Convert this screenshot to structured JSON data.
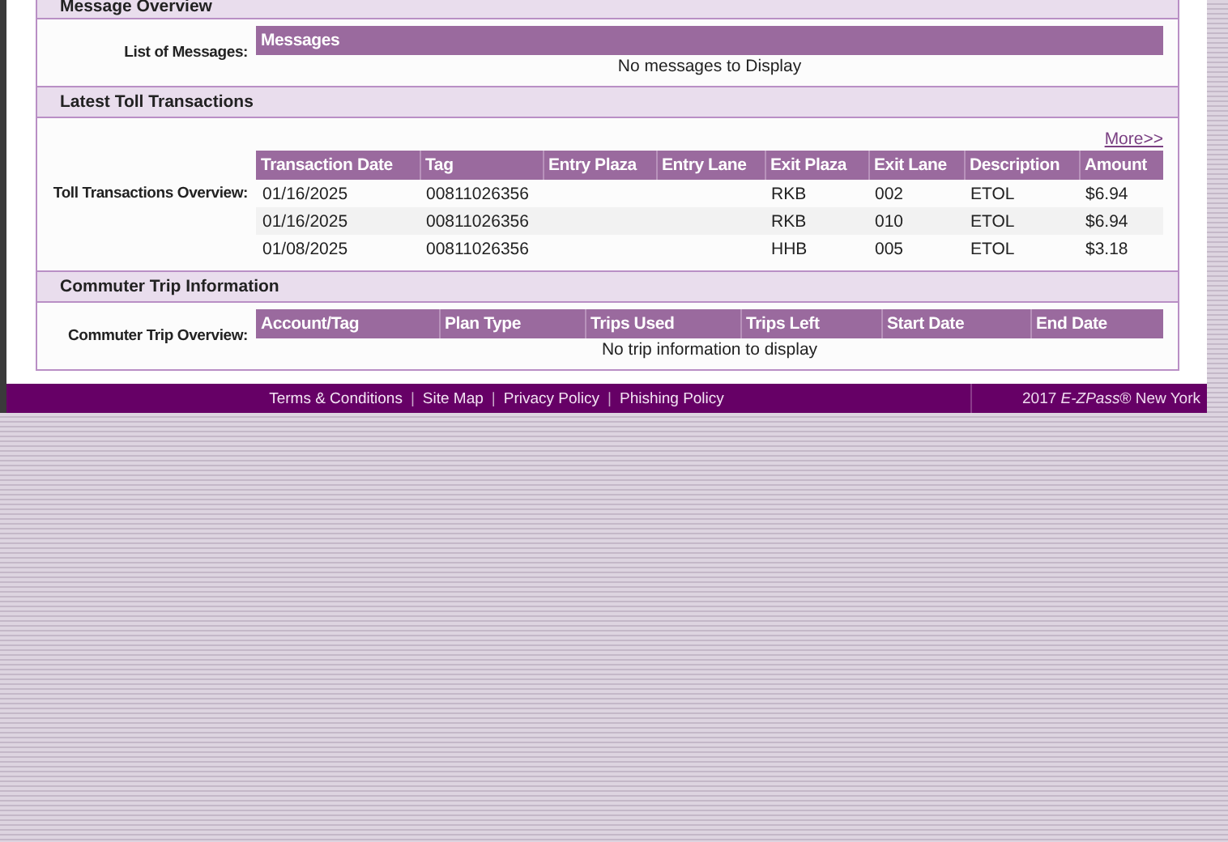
{
  "sections": [
    {
      "title": "Message Overview",
      "label": "List of Messages:",
      "table": {
        "columns": [
          "Messages"
        ],
        "empty_message": "No messages to Display"
      }
    },
    {
      "title": "Latest Toll Transactions",
      "label": "Toll Transactions Overview:",
      "more_link": "More>>",
      "table": {
        "columns": [
          "Transaction Date",
          "Tag",
          "Entry Plaza",
          "Entry Lane",
          "Exit Plaza",
          "Exit Lane",
          "Description",
          "Amount"
        ],
        "rows": [
          [
            "01/16/2025",
            "00811026356",
            null,
            null,
            "RKB",
            "002",
            "ETOL",
            "$6.94"
          ],
          [
            "01/16/2025",
            "00811026356",
            null,
            null,
            "RKB",
            "010",
            "ETOL",
            "$6.94"
          ],
          [
            "01/08/2025",
            "00811026356",
            null,
            null,
            "HHB",
            "005",
            "ETOL",
            "$3.18"
          ]
        ]
      }
    },
    {
      "title": "Commuter Trip Information",
      "label": "Commuter Trip Overview:",
      "table": {
        "columns": [
          "Account/Tag",
          "Plan Type",
          "Trips Used",
          "Trips Left",
          "Start Date",
          "End Date"
        ],
        "empty_message": "No trip information to display"
      }
    }
  ],
  "footer": {
    "items": [
      {
        "kind": "link",
        "text": "Terms & Conditions"
      },
      {
        "kind": "separator",
        "text": "|"
      },
      {
        "kind": "link",
        "text": "Site Map"
      },
      {
        "kind": "separator",
        "text": "|"
      },
      {
        "kind": "link",
        "text": "Privacy Policy"
      },
      {
        "kind": "separator",
        "text": "|"
      },
      {
        "kind": "link",
        "text": "Phishing Policy"
      }
    ],
    "copyright": "2017 *E-ZPass*® New York"
  }
}
